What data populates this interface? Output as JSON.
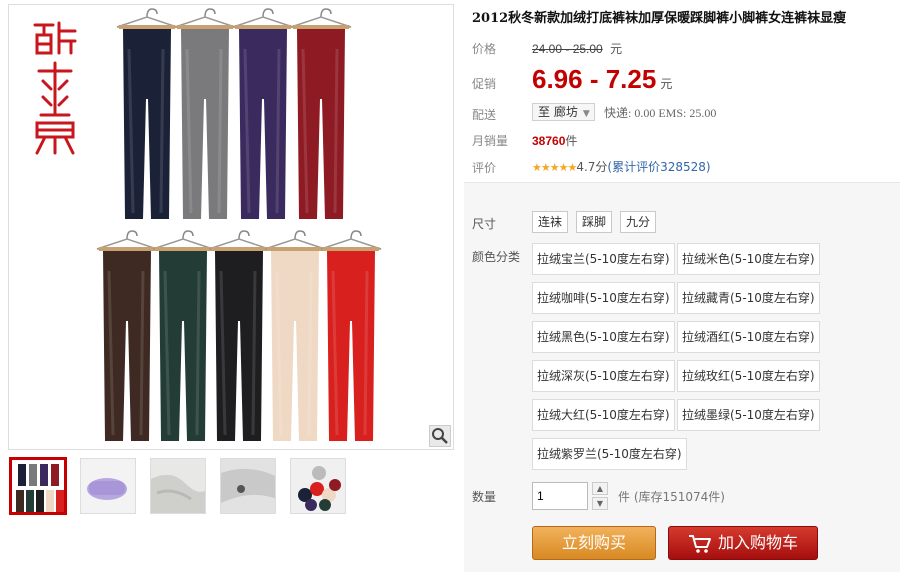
{
  "title": "2012秋冬新款加绒打底裤袜加厚保暖踩脚裤小脚裤女连裤袜显瘦",
  "brand_logo": "酷爽男",
  "price": {
    "label": "价格",
    "original": "24.00 - 25.00",
    "unit": "元"
  },
  "promo": {
    "label": "促销",
    "value": "6.96 - 7.25",
    "unit": "元"
  },
  "delivery": {
    "label": "配送",
    "location": "至 廊坊",
    "shipping": "快递: 0.00 EMS: 25.00"
  },
  "monthly_sales": {
    "label": "月销量",
    "value": "38760",
    "unit": "件"
  },
  "rating": {
    "label": "评价",
    "stars": "★★★★★",
    "score": "4.7分",
    "link": "(累计评价328528)"
  },
  "size": {
    "label": "尺寸",
    "options": [
      "连袜",
      "踩脚",
      "九分"
    ]
  },
  "color": {
    "label": "颜色分类",
    "options": [
      "拉绒宝兰(5-10度左右穿)",
      "拉绒米色(5-10度左右穿)",
      "拉绒咖啡(5-10度左右穿)",
      "拉绒藏青(5-10度左右穿)",
      "拉绒黑色(5-10度左右穿)",
      "拉绒酒红(5-10度左右穿)",
      "拉绒深灰(5-10度左右穿)",
      "拉绒玫红(5-10度左右穿)",
      "拉绒大红(5-10度左右穿)",
      "拉绒墨绿(5-10度左右穿)",
      "拉绒紫罗兰(5-10度左右穿)"
    ]
  },
  "quantity": {
    "label": "数量",
    "value": "1",
    "note": "件 (库存151074件)"
  },
  "buttons": {
    "buy_now": "立刻购买",
    "add_to_cart": "加入购物车"
  },
  "icons": {
    "zoom": "magnifier-icon",
    "cart": "cart-icon",
    "stepper_up": "triangle-up-icon",
    "stepper_down": "triangle-down-icon"
  },
  "colors": {
    "price_red": "#c40000",
    "buy_orange": "#e09a3a",
    "cart_red": "#b8141a"
  },
  "pants_colors_top": [
    "#1b2238",
    "#7a7a7c",
    "#3b2a5e",
    "#8e1a24"
  ],
  "pants_colors_bottom": [
    "#3e2a22",
    "#233d36",
    "#1e1e20",
    "#f0d9c4",
    "#d8201e"
  ]
}
